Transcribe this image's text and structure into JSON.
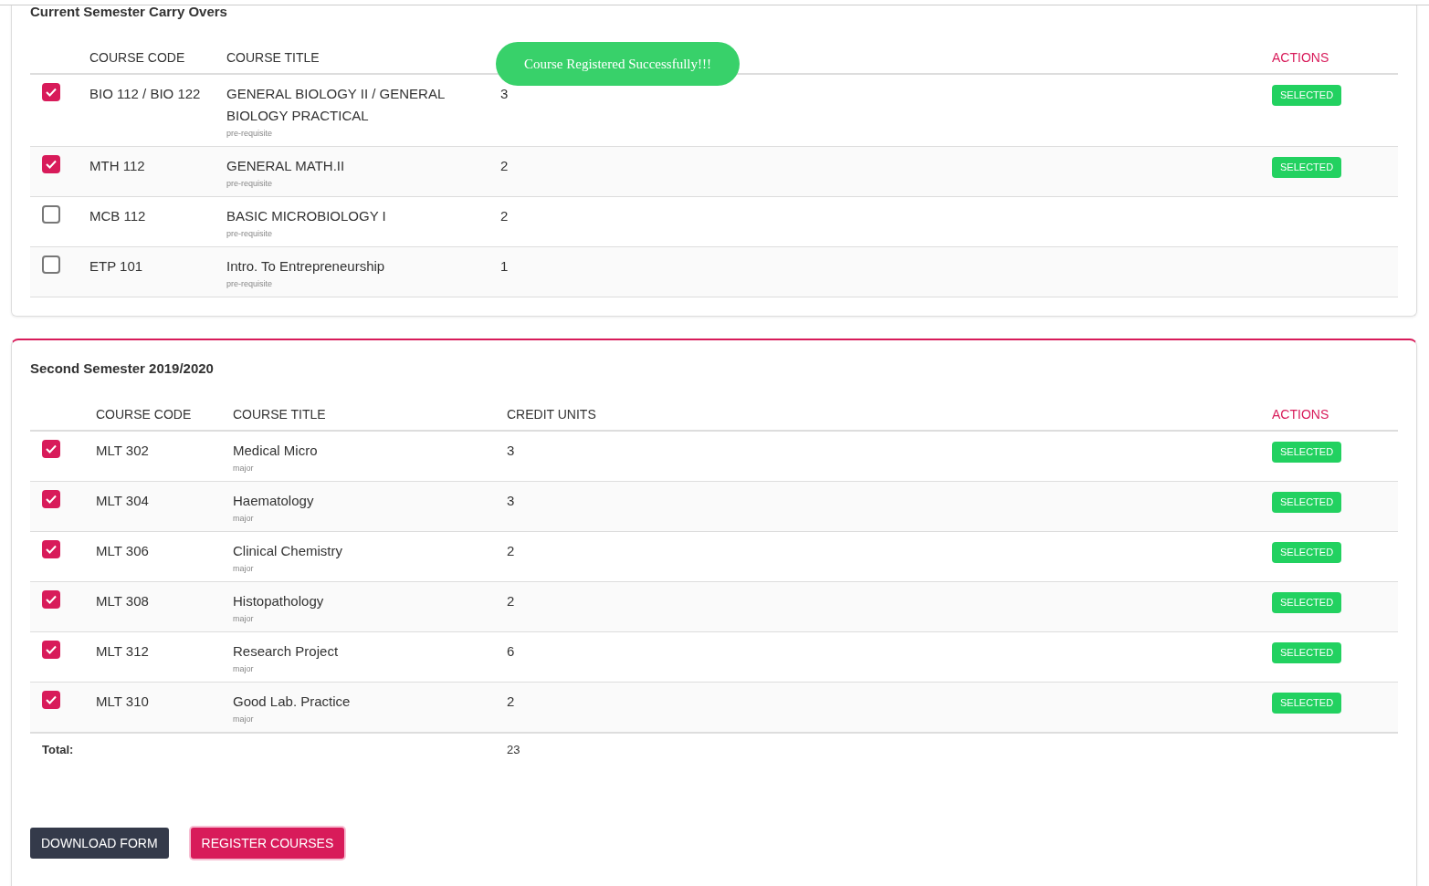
{
  "toast": {
    "text": "Course Registered Successfully!!!"
  },
  "sections": [
    {
      "title": "Current Semester Carry Overs",
      "highlighted": false,
      "columns": [
        "COURSE CODE",
        "COURSE TITLE"
      ],
      "actions_label": "ACTIONS",
      "rows": [
        {
          "checked": true,
          "code": "BIO 112 / BIO 122",
          "title": "GENERAL BIOLOGY II / GENERAL BIOLOGY PRACTICAL",
          "tag": "pre-requisite",
          "units": "3",
          "action": "SELECTED"
        },
        {
          "checked": true,
          "code": "MTH 112",
          "title": "GENERAL MATH.II",
          "tag": "pre-requisite",
          "units": "2",
          "action": "SELECTED"
        },
        {
          "checked": false,
          "code": "MCB 112",
          "title": "BASIC MICROBIOLOGY I",
          "tag": "pre-requisite",
          "units": "2"
        },
        {
          "checked": false,
          "code": "ETP 101",
          "title": "Intro. To Entrepreneurship",
          "tag": "pre-requisite",
          "units": "1"
        }
      ]
    },
    {
      "title": "Second Semester 2019/2020",
      "highlighted": true,
      "columns": [
        "COURSE CODE",
        "COURSE TITLE",
        "CREDIT UNITS"
      ],
      "actions_label": "ACTIONS",
      "rows": [
        {
          "checked": true,
          "code": "MLT 302",
          "title": "Medical Micro",
          "tag": "major",
          "units": "3",
          "action": "SELECTED"
        },
        {
          "checked": true,
          "code": "MLT 304",
          "title": "Haematology",
          "tag": "major",
          "units": "3",
          "action": "SELECTED"
        },
        {
          "checked": true,
          "code": "MLT 306",
          "title": "Clinical Chemistry",
          "tag": "major",
          "units": "2",
          "action": "SELECTED"
        },
        {
          "checked": true,
          "code": "MLT 308",
          "title": "Histopathology",
          "tag": "major",
          "units": "2",
          "action": "SELECTED"
        },
        {
          "checked": true,
          "code": "MLT 312",
          "title": "Research Project",
          "tag": "major",
          "units": "6",
          "action": "SELECTED"
        },
        {
          "checked": true,
          "code": "MLT 310",
          "title": "Good Lab. Practice",
          "tag": "major",
          "units": "2",
          "action": "SELECTED"
        }
      ],
      "total": {
        "label": "Total:",
        "value": "23"
      },
      "buttons": [
        {
          "label": "DOWNLOAD FORM",
          "kind": "dark"
        },
        {
          "label": "REGISTER COURSES",
          "kind": "primary"
        }
      ]
    }
  ]
}
